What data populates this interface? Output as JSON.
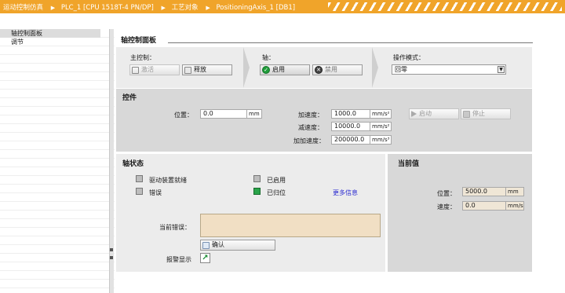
{
  "header": {
    "breadcrumb": [
      "运动控制仿真",
      "PLC_1 [CPU 1518T-4 PN/DP]",
      "工艺对象",
      "PositioningAxis_1 [DB1]"
    ]
  },
  "tree": {
    "items": [
      {
        "label": "轴控制面板",
        "selected": true
      },
      {
        "label": "调节",
        "selected": false
      }
    ]
  },
  "panel_title": "轴控制面板",
  "master_control": {
    "label": "主控制：",
    "activate_label": "激活",
    "release_label": "释放"
  },
  "axis": {
    "label": "轴：",
    "enable_label": "启用",
    "disable_label": "禁用"
  },
  "operating_mode": {
    "label": "操作模式：",
    "selected": "回零"
  },
  "controls": {
    "title": "控件",
    "position_label": "位置：",
    "position_value": "0.0",
    "position_unit": "mm",
    "accel_label": "加速度：",
    "accel_value": "1000.0",
    "accel_unit": "mm/s²",
    "decel_label": "减速度：",
    "decel_value": "10000.0",
    "decel_unit": "mm/s²",
    "jerk_label": "加加速度：",
    "jerk_value": "200000.0",
    "jerk_unit": "mm/s³",
    "start_label": "启动",
    "stop_label": "停止"
  },
  "axis_status": {
    "title": "轴状态",
    "drive_ready_label": "驱动装置就绪",
    "enabled_label": "已启用",
    "error_label": "错误",
    "homed_label": "已归位",
    "more_info_label": "更多信息",
    "current_error_label": "当前错误：",
    "current_error_value": "",
    "confirm_label": "确认",
    "alarm_display_label": "报警显示"
  },
  "current_values": {
    "title": "当前值",
    "position_label": "位置：",
    "position_value": "5000.0",
    "position_unit": "mm",
    "velocity_label": "速度：",
    "velocity_value": "0.0",
    "velocity_unit": "mm/s"
  },
  "colors": {
    "header_orange": "#f0a42a",
    "status_green": "#2aa44a",
    "readonly_fill": "#efe6d6",
    "link_blue": "#2b2bd1"
  }
}
